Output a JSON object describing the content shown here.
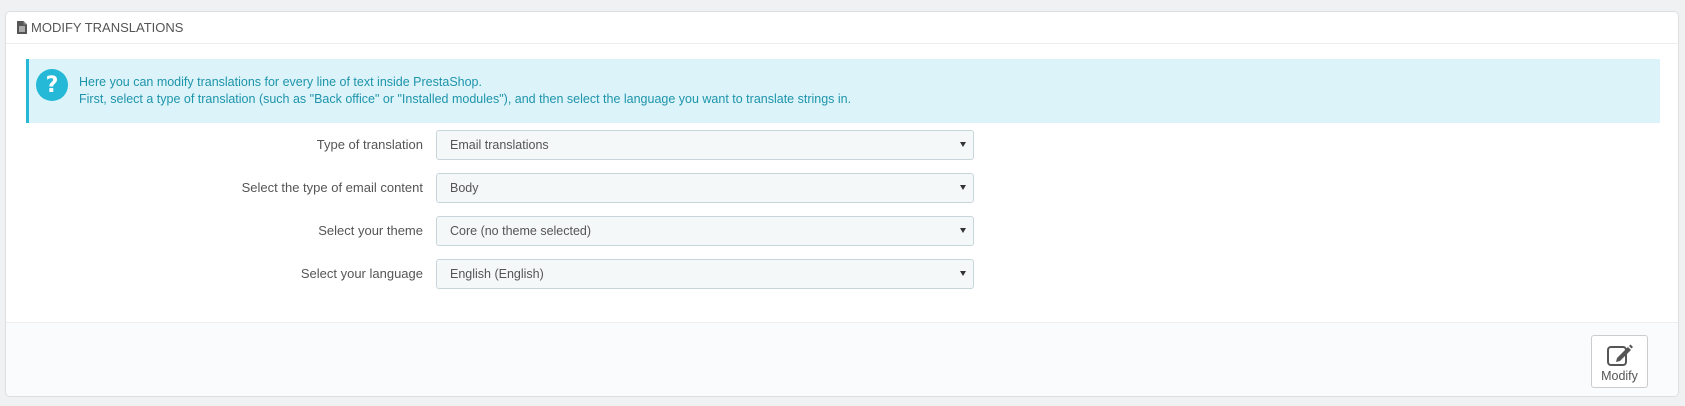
{
  "panel": {
    "title": "MODIFY TRANSLATIONS",
    "title_icon": "document-icon"
  },
  "alert": {
    "icon": "question-icon",
    "line1": "Here you can modify translations for every line of text inside PrestaShop.",
    "line2": "First, select a type of translation (such as \"Back office\" or \"Installed modules\"), and then select the language you want to translate strings in.",
    "accent_color": "#25b9d7"
  },
  "form": {
    "fields": [
      {
        "label": "Type of translation",
        "value": "Email translations"
      },
      {
        "label": "Select the type of email content",
        "value": "Body"
      },
      {
        "label": "Select your theme",
        "value": "Core (no theme selected)"
      },
      {
        "label": "Select your language",
        "value": "English (English)"
      }
    ]
  },
  "footer": {
    "modify_label": "Modify",
    "modify_icon": "edit-icon"
  }
}
